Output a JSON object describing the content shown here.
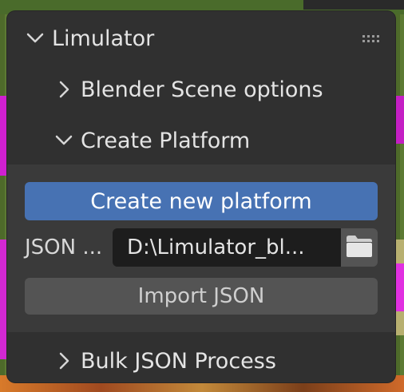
{
  "panel": {
    "title": "Limulator",
    "sections": [
      {
        "label": "Blender Scene options",
        "expanded": false
      },
      {
        "label": "Create Platform",
        "expanded": true
      },
      {
        "label": "Bulk JSON Process",
        "expanded": false
      }
    ]
  },
  "create_platform": {
    "create_button_label": "Create new platform",
    "json_label": "JSON ...",
    "json_path_value": "D:\\Limulator_bl...",
    "import_button_label": "Import JSON"
  },
  "colors": {
    "panel_bg": "#303030",
    "subpanel_bg": "#3a3a3a",
    "accent": "#4772b3",
    "field_bg": "#1d1d1d",
    "button_bg": "#545454"
  },
  "icons": {
    "header_chevron": "chevron-down-icon",
    "grip": "grip-dots-icon",
    "folder": "folder-icon"
  }
}
